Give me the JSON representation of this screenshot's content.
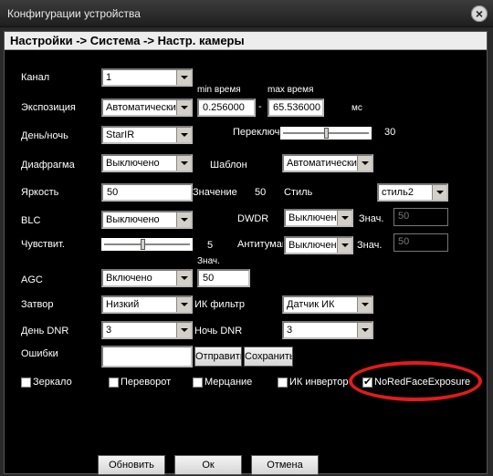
{
  "window": {
    "title": "Конфигурации устройства"
  },
  "heading": "Настройки -> Система -> Настр. камеры",
  "fields": {
    "channel": {
      "label": "Канал",
      "value": "1"
    },
    "exposure": {
      "label": "Экспозиция",
      "value": "Автоматически",
      "min_label": "min время",
      "max_label": "max время",
      "min_value": "0.256000",
      "max_value": "65.536000",
      "dash": "-",
      "unit": "мс"
    },
    "daynight": {
      "label": "День/ночь",
      "value": "StarIR",
      "switch_label": "Переключение",
      "switch_value": "30",
      "switch_level": 0.5
    },
    "iris": {
      "label": "Диафрагма",
      "value": "Выключено",
      "template_label": "Шаблон",
      "template_value": "Автоматически"
    },
    "brightness": {
      "label": "Яркость",
      "value": "50",
      "value_label": "Значение",
      "value_number": "50",
      "style_label": "Стиль",
      "style_value": "стиль2"
    },
    "blc": {
      "label": "BLC",
      "value": "Выключено",
      "dwdr_label": "DWDR",
      "dwdr_value": "Выключено",
      "znach_label": "Знач.",
      "znach_value": "50"
    },
    "sensitivity": {
      "label": "Чувствит.",
      "value": "5",
      "level": 0.45,
      "antifog_label": "Антитумаг",
      "antifog_value": "Выключено",
      "znach_label": "Знач.",
      "znach_value": "50"
    },
    "agc": {
      "label": "AGC",
      "value": "Включено",
      "znach_label": "Знач.",
      "znach_value": "50"
    },
    "shutter": {
      "label": "Затвор",
      "value": "Низкий",
      "ir_label": "ИК фильтр",
      "ir_value": "Датчик ИК"
    },
    "dnr_day": {
      "label": "День DNR",
      "value": "3",
      "night_label": "Ночь DNR",
      "night_value": "3"
    },
    "errors": {
      "label": "Ошибки",
      "value": "",
      "send_label": "Отправить",
      "save_label": "Сохранить"
    }
  },
  "checkboxes": [
    {
      "label": "Зеркало",
      "checked": false
    },
    {
      "label": "Переворот",
      "checked": false
    },
    {
      "label": "Мерцание",
      "checked": false
    },
    {
      "label": "ИК инвертор",
      "checked": false
    },
    {
      "label": "NoRedFaceExposure",
      "checked": true
    }
  ],
  "buttons": {
    "refresh": "Обновить",
    "ok": "Ок",
    "cancel": "Отмена"
  },
  "colors": {
    "highlight_ring": "#e21b1b"
  }
}
